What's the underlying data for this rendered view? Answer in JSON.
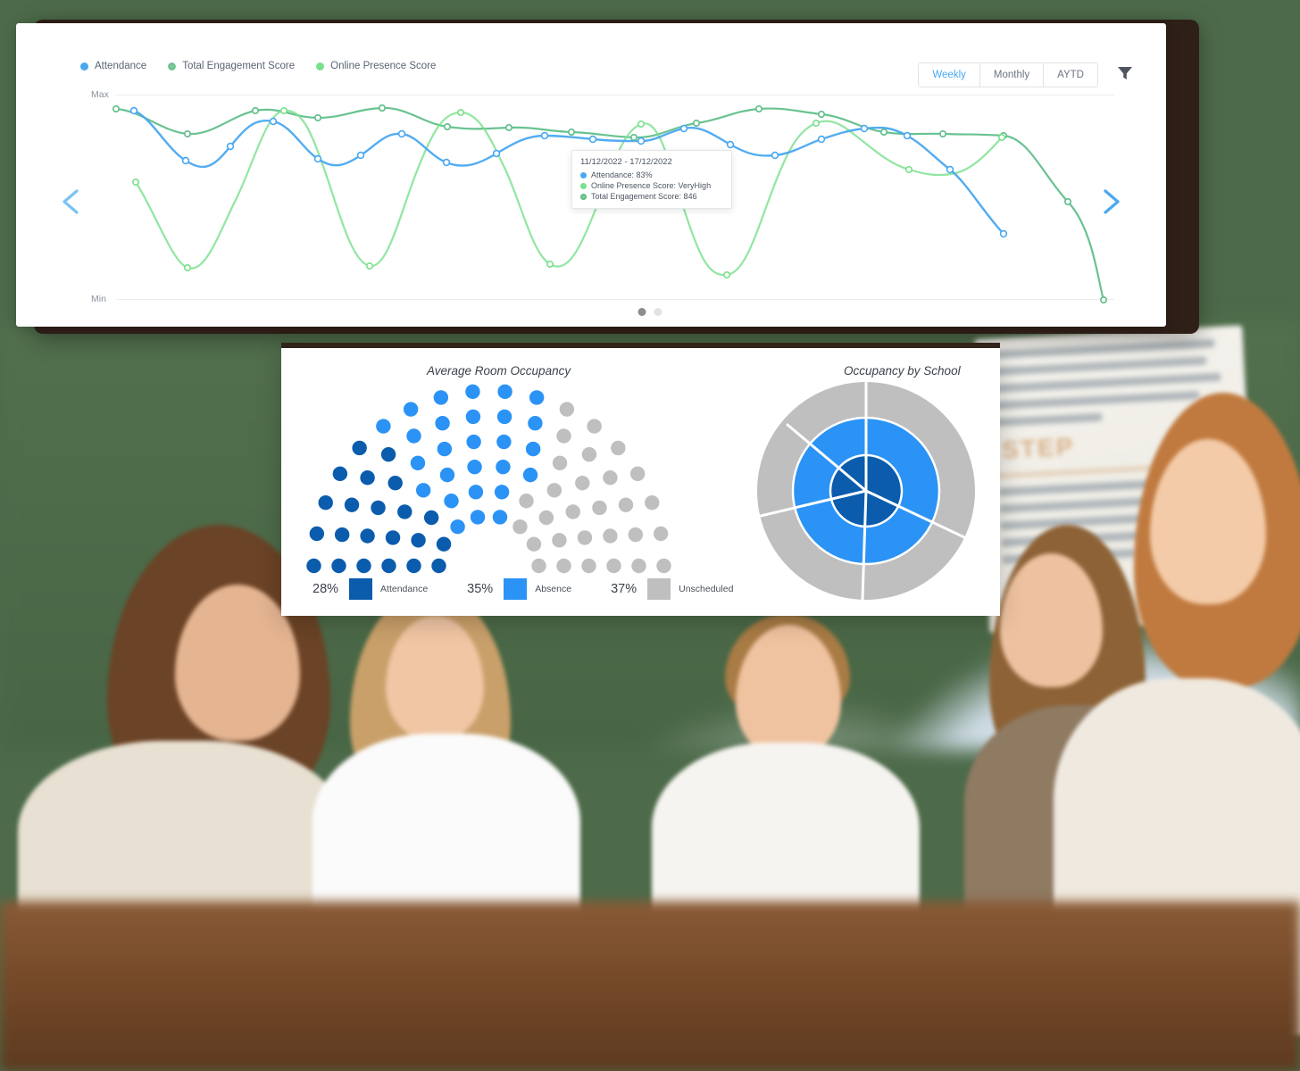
{
  "colors": {
    "attendance_blue": "#4aa8f0",
    "engagement_green": "#5cbd88",
    "presence_green": "#79e08c",
    "dark_blue": "#0b5cad",
    "light_blue": "#2b93f5",
    "grey": "#bfbfbf",
    "frame_dark": "#2e1f17"
  },
  "line_panel": {
    "legend": [
      {
        "label": "Attendance",
        "marker": "solid-dot",
        "color": "#4aa8f0"
      },
      {
        "label": "Total Engagement Score",
        "marker": "mesh-dot",
        "color": "#5cbd88"
      },
      {
        "label": "Online Presence Score",
        "marker": "solid-dot",
        "color": "#79e08c"
      }
    ],
    "range_buttons": [
      {
        "label": "Weekly",
        "active": true
      },
      {
        "label": "Monthly",
        "active": false
      },
      {
        "label": "AYTD",
        "active": false
      }
    ],
    "filter_icon": "funnel-icon",
    "axis": {
      "max_label": "Max",
      "min_label": "Min"
    },
    "nav": {
      "prev_icon": "chevron-left-icon",
      "next_icon": "chevron-right-icon"
    },
    "pager": [
      {
        "active": true
      },
      {
        "active": false
      }
    ],
    "tooltip": {
      "date_range": "11/12/2022 - 17/12/2022",
      "rows": [
        {
          "label": "Attendance: 83%",
          "color": "#4aa8f0",
          "marker": "solid-dot"
        },
        {
          "label": "Online Presence Score: VeryHigh",
          "color": "#79e08c",
          "marker": "solid-dot"
        },
        {
          "label": "Total Engagement Score: 846",
          "color": "#5cbd88",
          "marker": "mesh-dot"
        }
      ]
    }
  },
  "occupancy_panel": {
    "left_title": "Average Room Occupancy",
    "right_title": "Occupancy by School",
    "legend": [
      {
        "pct": "28%",
        "name": "Attendance",
        "color": "#0b5cad"
      },
      {
        "pct": "35%",
        "name": "Absence",
        "color": "#2b93f5"
      },
      {
        "pct": "37%",
        "name": "Unscheduled",
        "color": "#bfbfbf"
      }
    ]
  },
  "backdrop": {
    "poster_text": [
      "In consectetur convallis",
      "tor sit amet tempor.",
      "ean ac turpis laoreet.",
      "quet lorem sit amet,",
      "estas odio."
    ],
    "poster_heading": "STEP",
    "poster_text2": [
      "Sed tempor lacinia",
      "cus aliquet",
      "Fusce mi turpis,",
      "at faucibus vel,",
      "eget turpis."
    ]
  },
  "chart_data": [
    {
      "type": "line",
      "title": "",
      "xlabel": "",
      "ylabel": "",
      "ylim": [
        "Min",
        "Max"
      ],
      "grid": false,
      "legend_position": "top-left",
      "x": [
        0,
        1,
        2,
        3,
        4,
        5,
        6,
        7,
        8,
        9,
        10,
        11,
        12,
        13,
        14,
        15,
        16,
        17,
        18,
        19
      ],
      "series": [
        {
          "name": "Attendance",
          "color": "#4aa8f0",
          "values": [
            0.86,
            0.66,
            0.86,
            0.74,
            0.6,
            0.72,
            0.87,
            0.64,
            0.8,
            0.8,
            0.82,
            0.83,
            0.88,
            0.92,
            0.92,
            0.89,
            0.85,
            0.8,
            0.57,
            null
          ],
          "end_index": 18
        },
        {
          "name": "Total Engagement Score",
          "color": "#5cbd88",
          "values": [
            0.93,
            0.85,
            0.93,
            0.89,
            0.9,
            0.9,
            0.9,
            0.92,
            0.9,
            0.88,
            0.86,
            0.88,
            0.9,
            0.93,
            0.92,
            0.9,
            0.88,
            0.88,
            0.7,
            0.04
          ],
          "end_index": 19
        },
        {
          "name": "Online Presence Score",
          "color": "#79e08c",
          "values": [
            0.66,
            0.33,
            0.93,
            0.9,
            0.14,
            0.6,
            0.92,
            0.8,
            0.6,
            0.34,
            0.74,
            0.92,
            0.86,
            0.84,
            0.66,
            0.4,
            0.52,
            0.91,
            null,
            null
          ],
          "end_index": 17
        }
      ]
    },
    {
      "type": "pie",
      "variant": "hemicycle-dot",
      "title": "Average Room Occupancy",
      "labels": [
        "Attendance",
        "Absence",
        "Unscheduled"
      ],
      "values": [
        28,
        35,
        37
      ],
      "colors": [
        "#0b5cad",
        "#2b93f5",
        "#bfbfbf"
      ],
      "units": "percent",
      "total_dots": 100
    },
    {
      "type": "pie",
      "variant": "nested-donut",
      "title": "Occupancy by School",
      "rings": [
        {
          "name": "inner",
          "color": "#0b5cad",
          "segments": [
            30,
            25,
            45
          ]
        },
        {
          "name": "middle",
          "color": "#2b93f5",
          "segments": [
            28,
            22,
            20,
            30
          ]
        },
        {
          "name": "outer",
          "color": "#bfbfbf",
          "segments": [
            22,
            18,
            25,
            20,
            15
          ]
        }
      ],
      "colors": [
        "#0b5cad",
        "#2b93f5",
        "#bfbfbf"
      ]
    }
  ]
}
